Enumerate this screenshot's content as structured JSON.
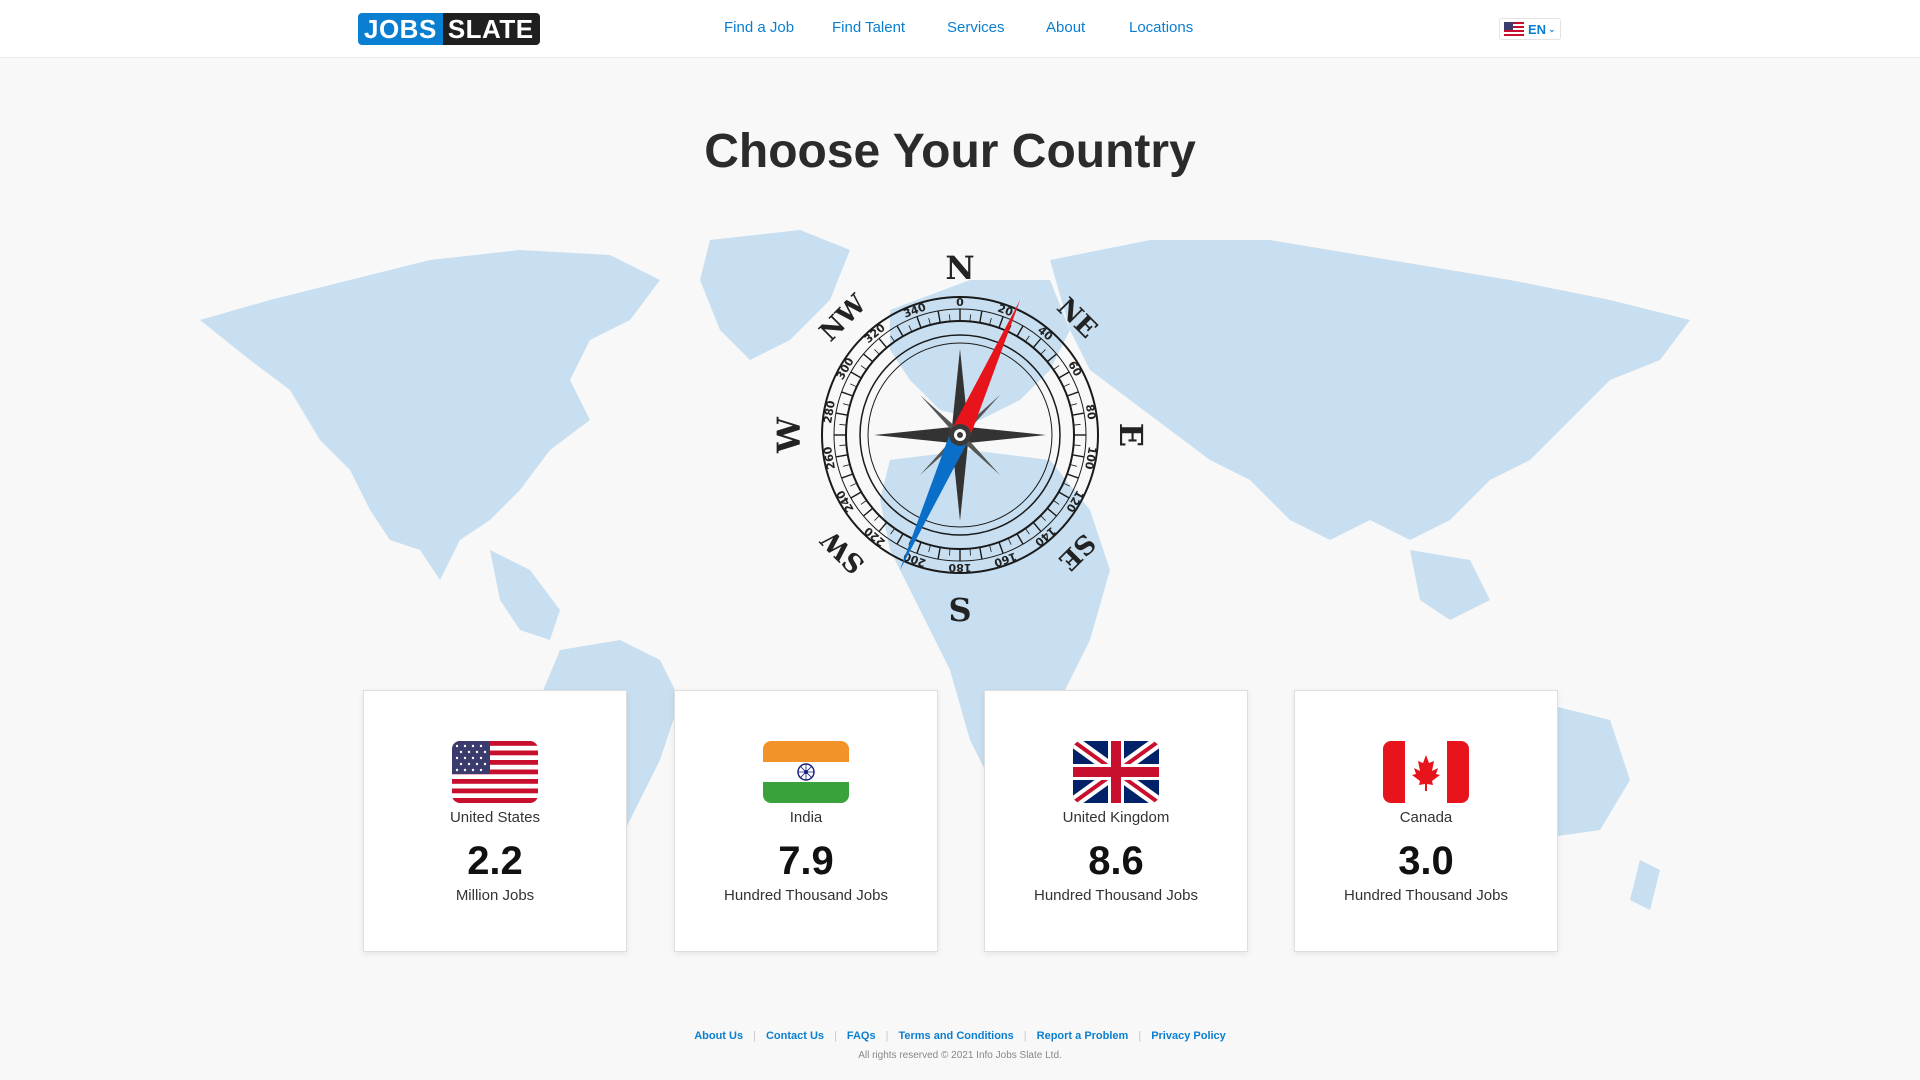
{
  "header": {
    "logo": {
      "part1": "JOBS",
      "part2": "SLATE"
    },
    "nav": [
      {
        "label": "Find a Job"
      },
      {
        "label": "Find Talent"
      },
      {
        "label": "Services"
      },
      {
        "label": "About"
      },
      {
        "label": "Locations"
      }
    ],
    "language": {
      "label": "EN",
      "flag_icon": "us-flag-icon"
    }
  },
  "main": {
    "title": "Choose Your Country",
    "compass": {
      "cardinals": [
        "N",
        "NE",
        "E",
        "SE",
        "S",
        "SW",
        "W",
        "NW"
      ],
      "degree_labels": [
        "0",
        "20",
        "40",
        "60",
        "80",
        "100",
        "120",
        "140",
        "160",
        "180",
        "200",
        "220",
        "240",
        "260",
        "280",
        "300",
        "320",
        "340"
      ]
    },
    "countries": [
      {
        "name": "United States",
        "count": "2.2",
        "unit": "Million Jobs",
        "flag_icon": "us-flag-icon"
      },
      {
        "name": "India",
        "count": "7.9",
        "unit": "Hundred Thousand Jobs",
        "flag_icon": "india-flag-icon"
      },
      {
        "name": "United Kingdom",
        "count": "8.6",
        "unit": "Hundred Thousand Jobs",
        "flag_icon": "uk-flag-icon"
      },
      {
        "name": "Canada",
        "count": "3.0",
        "unit": "Hundred Thousand Jobs",
        "flag_icon": "canada-flag-icon"
      }
    ]
  },
  "footer": {
    "links": [
      {
        "label": "About Us"
      },
      {
        "label": "Contact Us"
      },
      {
        "label": "FAQs"
      },
      {
        "label": "Terms and Conditions"
      },
      {
        "label": "Report a Problem"
      },
      {
        "label": "Privacy Policy"
      }
    ],
    "copyright": "All rights reserved © 2021 Info Jobs Slate Ltd."
  },
  "colors": {
    "brand_blue": "#0a7fd1",
    "logo_dark": "#1f1f1f",
    "map_fill": "#c7dff0",
    "needle_red": "#e8141b",
    "needle_blue": "#0a6fc9"
  }
}
